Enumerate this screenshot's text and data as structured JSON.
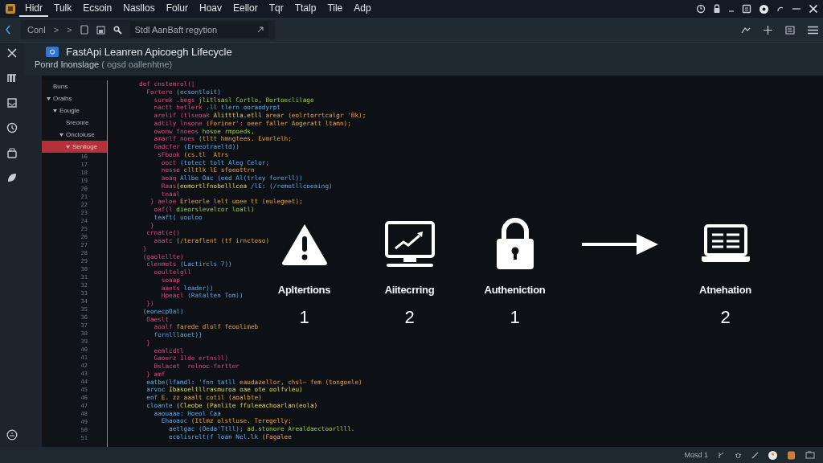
{
  "menu": [
    {
      "label": "Hidr",
      "selected": true
    },
    {
      "label": "Tulk",
      "selected": false
    },
    {
      "label": "Ecsoin",
      "selected": false
    },
    {
      "label": "Nasllos",
      "selected": false
    },
    {
      "label": "Folur",
      "selected": false
    },
    {
      "label": "Hoav",
      "selected": false
    },
    {
      "label": "Eellor",
      "selected": false
    },
    {
      "label": "Tqr",
      "selected": false
    },
    {
      "label": "Ttalp",
      "selected": false
    },
    {
      "label": "Tile",
      "selected": false
    },
    {
      "label": "Adp",
      "selected": false
    }
  ],
  "toolbar": {
    "breadcrumb": "Conl",
    "separators": [
      ">",
      ">"
    ],
    "search": {
      "value": "Stdl AanBaft regytion"
    }
  },
  "document": {
    "title": "FastApi Leanren Apicoegh Lifecycle",
    "subtitle": "Ponrd Inonslage",
    "subtitle_note": "( ogsd oallenhtne)"
  },
  "tree": [
    {
      "label": "Buns",
      "expanded": false,
      "selected": false
    },
    {
      "label": "Oralhs",
      "expanded": true,
      "selected": false,
      "children": [
        {
          "label": "Eougle",
          "expanded": true,
          "selected": false,
          "children": [
            {
              "label": "Sreonre",
              "expanded": false,
              "selected": false
            },
            {
              "label": "Oncloiuse",
              "expanded": true,
              "selected": false,
              "children": [
                {
                  "label": "Senlioge",
                  "expanded": true,
                  "selected": true
                }
              ]
            }
          ]
        }
      ]
    }
  ],
  "line_numbers": [
    "16",
    "17",
    "18",
    "19",
    "20",
    "21",
    "22",
    "23",
    "24",
    "25",
    "26",
    "27",
    "28",
    "29",
    "30",
    "31",
    "32",
    "33",
    "34",
    "35",
    "36",
    "37",
    "38",
    "39",
    "40",
    "41",
    "42",
    "43",
    "44",
    "45",
    "46",
    "47",
    "48",
    "49",
    "50",
    "51"
  ],
  "code": [
    {
      "tokens": [
        {
          "text": "        def cnstemrol(|",
          "kind": "keyword"
        }
      ]
    },
    {
      "tokens": [
        {
          "text": "          Fortere ",
          "kind": "keyword"
        },
        {
          "text": "(ecsontloit)",
          "kind": "name"
        }
      ]
    },
    {
      "tokens": [
        {
          "text": "            surek .begs ",
          "kind": "keyword"
        },
        {
          "text": "jlitlsasl Cortlo, Bortoeclilage",
          "kind": "string"
        }
      ]
    },
    {
      "tokens": [
        {
          "text": "            nactt hetlerk ",
          "kind": "keyword"
        },
        {
          "text": ".ll tlern ooraodyrpt",
          "kind": "name"
        }
      ]
    },
    {
      "tokens": [
        {
          "text": "            arelif (tlseoak ",
          "kind": "keyword"
        },
        {
          "text": "Alitttla.etll ",
          "kind": "type"
        },
        {
          "text": "arear (eolrtorrtcalgr 'Bk);",
          "kind": "literal"
        }
      ]
    },
    {
      "tokens": [
        {
          "text": "            adtily lnsone ",
          "kind": "keyword"
        },
        {
          "text": "(Foriner': oeer faller Aogeratt ltamn);",
          "kind": "literal"
        }
      ]
    },
    {
      "tokens": [
        {
          "text": "            owonw fnoeos ",
          "kind": "keyword"
        },
        {
          "text": "hosoe rmpoeds,",
          "kind": "string"
        }
      ]
    },
    {
      "tokens": [
        {
          "text": "            amarlf noes ",
          "kind": "keyword"
        },
        {
          "text": "(tltt hmngtees. Evmrlelh;",
          "kind": "literal"
        }
      ]
    },
    {
      "tokens": [
        {
          "text": "            Gadcfer ",
          "kind": "keyword"
        },
        {
          "text": "(Ereeotraeltd))",
          "kind": "name"
        }
      ]
    },
    {
      "tokens": [
        {
          "text": "             sFbook ",
          "kind": "keyword"
        },
        {
          "text": "(cs.tl  Atrs",
          "kind": "literal"
        }
      ]
    },
    {
      "tokens": [
        {
          "text": "              ooct ",
          "kind": "keyword"
        },
        {
          "text": "(totect tolt Aleg Celor;",
          "kind": "name"
        }
      ]
    },
    {
      "tokens": [
        {
          "text": "              nesse ",
          "kind": "keyword"
        },
        {
          "text": "clltlk lE sfoeottrn",
          "kind": "literal"
        }
      ]
    },
    {
      "tokens": [
        {
          "text": "              aoaq ",
          "kind": "keyword"
        },
        {
          "text": "Allbe Oac (eed Al(trley forerll))",
          "kind": "name"
        }
      ]
    },
    {
      "tokens": [
        {
          "text": "              Raas",
          "kind": "keyword"
        },
        {
          "text": "(eomortlfnobelllcea ",
          "kind": "type"
        },
        {
          "text": "/lE: (/remetllcoeaing)",
          "kind": "name"
        }
      ]
    },
    {
      "tokens": [
        {
          "text": "              tnaal",
          "kind": "keyword"
        }
      ]
    },
    {
      "tokens": [
        {
          "text": "           } aeloe ",
          "kind": "keyword"
        },
        {
          "text": "Erleorle lelt uoee tt (eulegeet);",
          "kind": "literal"
        }
      ]
    },
    {
      "tokens": [
        {
          "text": "            oaf(l ",
          "kind": "keyword"
        },
        {
          "text": "dieorslevelcor loatl)",
          "kind": "string"
        }
      ]
    },
    {
      "tokens": [
        {
          "text": "            teaft( uouloo",
          "kind": "name"
        }
      ]
    },
    {
      "tokens": [
        {
          "text": "           }",
          "kind": "keyword"
        }
      ]
    },
    {
      "tokens": [
        {
          "text": "          crnat(e()",
          "kind": "keyword"
        }
      ]
    },
    {
      "tokens": [
        {
          "text": "            aaatc ",
          "kind": "keyword"
        },
        {
          "text": "(/teraflent (tf irnctoso)",
          "kind": "literal"
        }
      ]
    },
    {
      "tokens": [
        {
          "text": "         }",
          "kind": "keyword"
        }
      ]
    },
    {
      "tokens": [
        {
          "text": "         (gaolellte)",
          "kind": "keyword"
        }
      ]
    },
    {
      "tokens": [
        {
          "text": "          clenmets ",
          "kind": "keyword"
        },
        {
          "text": "(Lactircls 7))",
          "kind": "name"
        }
      ]
    },
    {
      "tokens": [
        {
          "text": "            ooultelgll",
          "kind": "keyword"
        }
      ]
    },
    {
      "tokens": [
        {
          "text": "              soaap",
          "kind": "keyword"
        }
      ]
    },
    {
      "tokens": [
        {
          "text": "              aaets ",
          "kind": "keyword"
        },
        {
          "text": "loader))",
          "kind": "name"
        }
      ]
    },
    {
      "tokens": [
        {
          "text": "              Hpeacl ",
          "kind": "keyword"
        },
        {
          "text": "(Ratalten Tom))",
          "kind": "name"
        }
      ]
    },
    {
      "tokens": [
        {
          "text": "          })",
          "kind": "keyword"
        }
      ]
    },
    {
      "tokens": [
        {
          "text": "         (eonecpOal)",
          "kind": "name"
        }
      ]
    },
    {
      "tokens": [
        {
          "text": "          Oaeslt",
          "kind": "keyword"
        }
      ]
    },
    {
      "tokens": [
        {
          "text": "            aoalf ",
          "kind": "keyword"
        },
        {
          "text": "farede dlolf feoolimeb",
          "kind": "literal"
        }
      ]
    },
    {
      "tokens": [
        {
          "text": "            fornlllaoet)}",
          "kind": "name"
        }
      ]
    },
    {
      "tokens": [
        {
          "text": "          }",
          "kind": "keyword"
        }
      ]
    },
    {
      "tokens": [
        {
          "text": "            eemlcdtl",
          "kind": "keyword"
        }
      ]
    },
    {
      "tokens": [
        {
          "text": "            Gaoerz Ilde ertnsll)",
          "kind": "keyword"
        }
      ]
    },
    {
      "tokens": [
        {
          "text": "            Bslacet  relnoc-fertter",
          "kind": "keyword"
        }
      ]
    },
    {
      "tokens": [
        {
          "text": "          } amf",
          "kind": "keyword"
        }
      ]
    },
    {
      "tokens": [
        {
          "text": "          eatbe(lfamdl: 'fnn tatll ",
          "kind": "name"
        },
        {
          "text": "eaudazellor, chsl— fem (tongoele)",
          "kind": "literal"
        }
      ]
    },
    {
      "tokens": [
        {
          "text": "          arvoc ",
          "kind": "name"
        },
        {
          "text": "Ibasoeltllrasmuroa oae ote oolfvleu)",
          "kind": "type"
        }
      ]
    },
    {
      "tokens": [
        {
          "text": "          enf ",
          "kind": "name"
        },
        {
          "text": "E. zz aaalt cotil (aoalbte)",
          "kind": "literal"
        }
      ]
    },
    {
      "tokens": [
        {
          "text": "          cloante ",
          "kind": "name"
        },
        {
          "text": "(Cleobe (Panlite ffuleeachoarlan(eola)",
          "kind": "type"
        }
      ]
    },
    {
      "tokens": [
        {
          "text": "            aaouaae: Hoeol Caa",
          "kind": "name"
        }
      ]
    },
    {
      "tokens": [
        {
          "text": "              Ehaoaoc ",
          "kind": "name"
        },
        {
          "text": "(Itlmz olstluse. Teregelly;",
          "kind": "literal"
        }
      ]
    },
    {
      "tokens": [
        {
          "text": "                aetlgac (Oeda'Ttll); ",
          "kind": "name"
        },
        {
          "text": "ad.stonore Arealdaectoorllll.",
          "kind": "string"
        }
      ]
    },
    {
      "tokens": [
        {
          "text": "                ecolisrelt(f loan Nel.lk ",
          "kind": "name"
        },
        {
          "text": "(Fagalee",
          "kind": "literal"
        }
      ]
    }
  ],
  "flow": [
    {
      "kind": "step",
      "label": "Apltertions",
      "count": "1"
    },
    {
      "kind": "step",
      "label": "Aiitecrring",
      "count": "2"
    },
    {
      "kind": "step",
      "label": "Autheniction",
      "count": "1"
    },
    {
      "kind": "arrow"
    },
    {
      "kind": "step",
      "label": "Atnehation",
      "count": "2"
    }
  ],
  "status_bar": {
    "mode": "Mosd 1"
  }
}
